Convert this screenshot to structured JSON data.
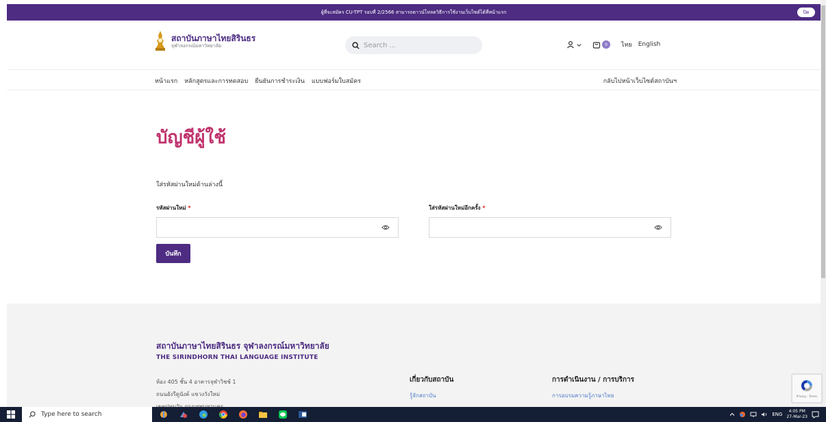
{
  "announcement": {
    "text": "ผู้ที่จะสมัคร CU-TPT รอบที่ 2/2566 สามารถดาวน์โหลดวิธีการใช้งานเว็บไซต์ได้ที่หน้าแรก",
    "close_label": "ปิด"
  },
  "header": {
    "logo_title": "สถาบันภาษาไทยสิรินธร",
    "logo_subtitle": "จุฬาลงกรณ์มหาวิทยาลัย",
    "search_placeholder": "Search ...",
    "cart_count": "0",
    "lang_th": "ไทย",
    "lang_en": "English"
  },
  "nav": {
    "items": [
      "หน้าแรก",
      "หลักสูตรและการทดสอบ",
      "ยืนยันการชำระเงิน",
      "แบบฟอร์มใบสมัคร"
    ],
    "back_link": "กลับไปหน้าเว็บไซต์สถาบันฯ"
  },
  "main": {
    "title": "บัญชีผู้ใช้",
    "instruction": "ใส่รหัสผ่านใหม่ด้านล่างนี้",
    "new_password_label": "รหัสผ่านใหม่",
    "confirm_password_label": "ใส่รหัสผ่านใหม่อีกครั้ง",
    "required_mark": "*",
    "save_label": "บันทึก"
  },
  "footer": {
    "org_th": "สถาบันภาษาไทยสิรินธร จุฬาลงกรณ์มหาวิทยาลัย",
    "org_en": "THE SIRINDHORN THAI LANGUAGE INSTITUTE",
    "address": [
      "ห้อง 405 ชั้น 4 อาคารจุฬาวิชช์ 1",
      "ถนนอังรีดูนังต์ แขวงวังใหม่",
      "เขตปทุมวัน กรุงเทพมหานคร"
    ],
    "col1_heading": "เกี่ยวกับสถาบัน",
    "col1_link": "รู้จักสถาบัน",
    "col2_heading": "การดำเนินงาน / การบริการ",
    "col2_link": "การอบรมความรู้ภาษาไทย",
    "recaptcha_text": "Privacy - Terms"
  },
  "taskbar": {
    "search_placeholder": "Type here to search",
    "lang": "ENG",
    "time": "4:05 PM",
    "date": "27-Mar-23"
  },
  "colors": {
    "brand": "#4d2c82",
    "title": "#c0336d",
    "taskbar": "#141e34"
  }
}
